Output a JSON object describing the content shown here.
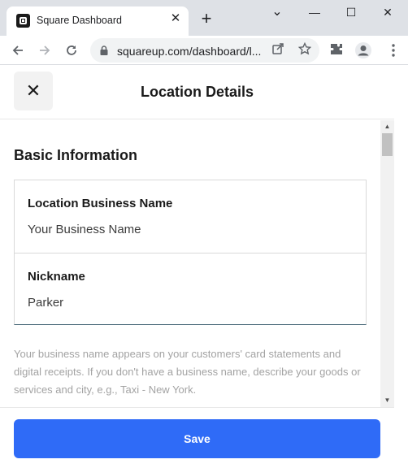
{
  "browser": {
    "tab_title": "Square Dashboard",
    "tab_close": "✕",
    "new_tab": "+",
    "url": "squareup.com/dashboard/l...",
    "window_controls": {
      "minimize": "—",
      "maximize": "☐",
      "close": "✕",
      "menu": "⌄"
    },
    "icons": [
      "square-logo-icon",
      "back-icon",
      "forward-icon",
      "reload-icon",
      "lock-icon",
      "share-icon",
      "star-icon",
      "extensions-icon",
      "profile-icon",
      "kebab-menu-icon"
    ]
  },
  "header": {
    "close_label": "✕",
    "title": "Location Details"
  },
  "basic_info": {
    "heading": "Basic Information",
    "fields": [
      {
        "label": "Location Business Name",
        "value": "Your Business Name"
      },
      {
        "label": "Nickname",
        "value": "Parker"
      }
    ],
    "help_text": "Your business name appears on your customers' card statements and digital receipts. If you don't have a business name, describe your goods or services and city, e.g., Taxi - New York."
  },
  "footer": {
    "save_label": "Save"
  },
  "colors": {
    "accent": "#2f6bf7",
    "help_text": "#a3a3a3",
    "chrome_bg": "#dee1e6"
  }
}
